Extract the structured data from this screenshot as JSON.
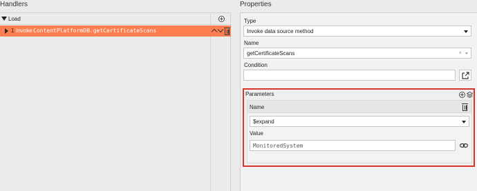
{
  "handlers": {
    "title": "Handlers",
    "group_label": "Load",
    "row": {
      "index": "1",
      "keyword": "Invoke",
      "method": "ContentPlatformDB.getCertificateScans"
    }
  },
  "properties": {
    "title": "Properties",
    "type": {
      "label": "Type",
      "value": "Invoke data source method"
    },
    "name": {
      "label": "Name",
      "value": "getCertificateScans"
    },
    "condition": {
      "label": "Condition",
      "value": ""
    },
    "parameters": {
      "label": "Parameters",
      "name": {
        "label": "Name",
        "value": "$expand"
      },
      "value": {
        "label": "Value",
        "value": "MonitoredSystem"
      }
    }
  },
  "colors": {
    "highlight_row": "#ff7e4f",
    "annotation_box": "#d9342b"
  },
  "icons": [
    "add-circle-icon",
    "caret-down-icon",
    "play-triangle-icon",
    "chevron-up-icon",
    "chevron-down-icon",
    "trash-icon",
    "external-link-icon",
    "layers-icon",
    "link-icon"
  ]
}
